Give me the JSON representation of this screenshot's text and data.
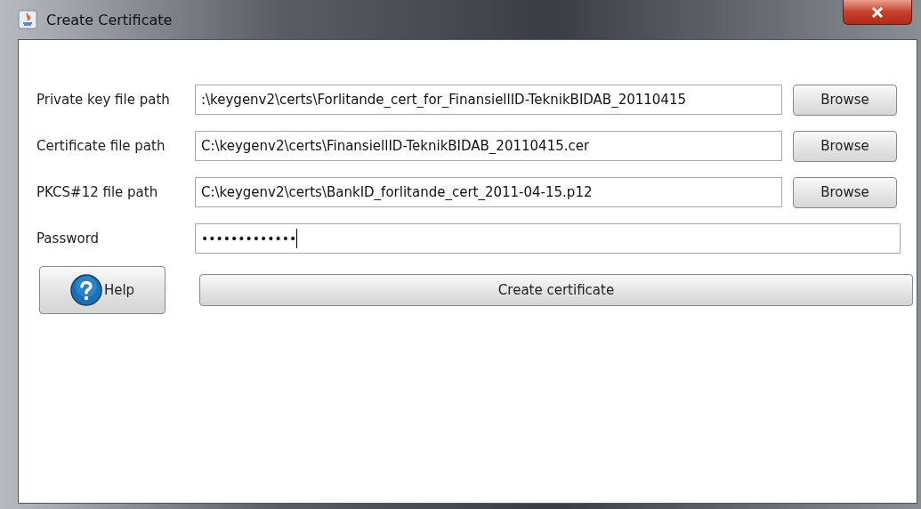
{
  "window": {
    "title": "Create Certificate"
  },
  "fields": [
    {
      "kind": "file",
      "label": "Private key file path",
      "value": ":\\keygenv2\\certs\\Forlitande_cert_for_FinansiellID-TeknikBIDAB_20110415",
      "button": "Browse"
    },
    {
      "kind": "file",
      "label": "Certificate file path",
      "value": "C:\\keygenv2\\certs\\FinansiellID-TeknikBIDAB_20110415.cer",
      "button": "Browse"
    },
    {
      "kind": "file",
      "label": "PKCS#12 file path",
      "value": "C:\\keygenv2\\certs\\BankID_forlitande_cert_2011-04-15.p12",
      "button": "Browse"
    },
    {
      "kind": "password",
      "label": "Password",
      "value": "•••••••••••••"
    }
  ],
  "help_button": "Help",
  "create_button": "Create certificate"
}
